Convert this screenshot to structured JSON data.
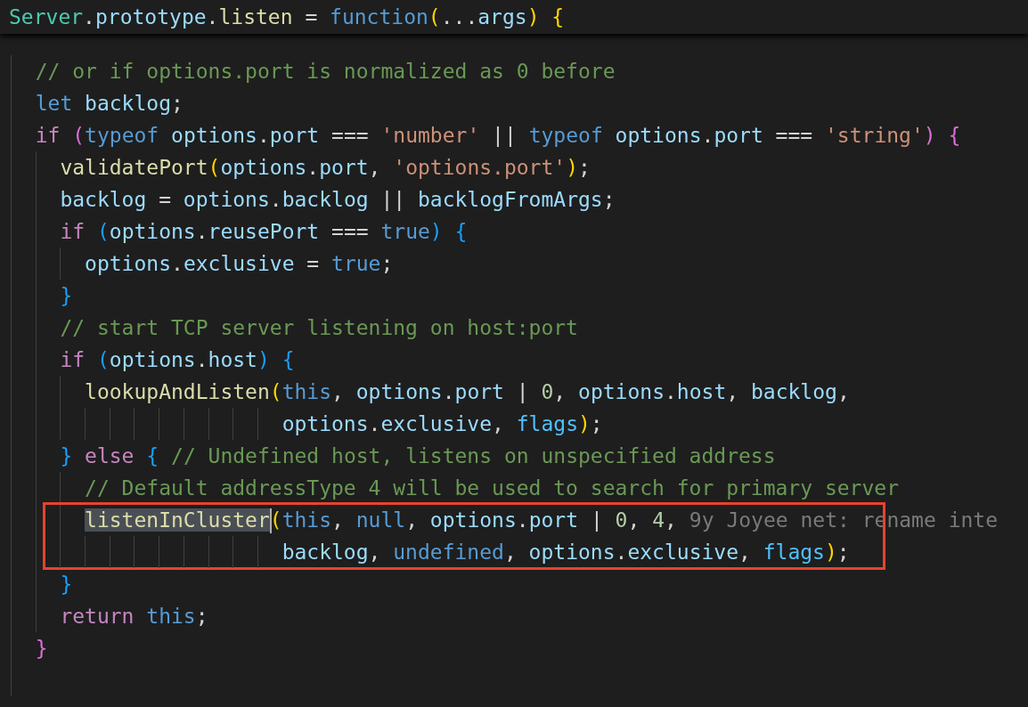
{
  "sticky_header": {
    "tokens": [
      {
        "kind": "cls",
        "text": "Server"
      },
      {
        "kind": "op",
        "text": "."
      },
      {
        "kind": "var",
        "text": "prototype"
      },
      {
        "kind": "op",
        "text": "."
      },
      {
        "kind": "fn",
        "text": "listen"
      },
      {
        "kind": "op",
        "text": " = "
      },
      {
        "kind": "kw",
        "text": "function"
      },
      {
        "kind": "b1",
        "text": "("
      },
      {
        "kind": "op",
        "text": "..."
      },
      {
        "kind": "var",
        "text": "args"
      },
      {
        "kind": "b1",
        "text": ")"
      },
      {
        "kind": "b1",
        "text": " {"
      }
    ]
  },
  "lines": [
    {
      "kind": "code",
      "boxed": false,
      "tokens": [
        {
          "kind": "cmt",
          "text": "// or if options.port is normalized as 0 before"
        }
      ]
    },
    {
      "kind": "code",
      "boxed": false,
      "tokens": [
        {
          "kind": "kw",
          "text": "let"
        },
        {
          "kind": "var",
          "text": " backlog"
        },
        {
          "kind": "op",
          "text": ";"
        }
      ]
    },
    {
      "kind": "code",
      "boxed": false,
      "tokens": [
        {
          "kind": "ctl",
          "text": "if"
        },
        {
          "kind": "b2",
          "text": " ("
        },
        {
          "kind": "kw",
          "text": "typeof"
        },
        {
          "kind": "var",
          "text": " options"
        },
        {
          "kind": "op",
          "text": "."
        },
        {
          "kind": "var",
          "text": "port"
        },
        {
          "kind": "op",
          "text": " === "
        },
        {
          "kind": "str",
          "text": "'number'"
        },
        {
          "kind": "op",
          "text": " || "
        },
        {
          "kind": "kw",
          "text": "typeof"
        },
        {
          "kind": "var",
          "text": " options"
        },
        {
          "kind": "op",
          "text": "."
        },
        {
          "kind": "var",
          "text": "port"
        },
        {
          "kind": "op",
          "text": " === "
        },
        {
          "kind": "str",
          "text": "'string'"
        },
        {
          "kind": "b2",
          "text": ")"
        },
        {
          "kind": "b2",
          "text": " {"
        }
      ],
      "children": [
        {
          "kind": "code",
          "boxed": false,
          "tokens": [
            {
              "kind": "fn",
              "text": "validatePort"
            },
            {
              "kind": "b1",
              "text": "("
            },
            {
              "kind": "var",
              "text": "options"
            },
            {
              "kind": "op",
              "text": "."
            },
            {
              "kind": "var",
              "text": "port"
            },
            {
              "kind": "op",
              "text": ", "
            },
            {
              "kind": "str",
              "text": "'options.port'"
            },
            {
              "kind": "b1",
              "text": ")"
            },
            {
              "kind": "op",
              "text": ";"
            }
          ]
        },
        {
          "kind": "code",
          "boxed": false,
          "tokens": [
            {
              "kind": "var",
              "text": "backlog"
            },
            {
              "kind": "op",
              "text": " = "
            },
            {
              "kind": "var",
              "text": "options"
            },
            {
              "kind": "op",
              "text": "."
            },
            {
              "kind": "var",
              "text": "backlog"
            },
            {
              "kind": "op",
              "text": " || "
            },
            {
              "kind": "var",
              "text": "backlogFromArgs"
            },
            {
              "kind": "op",
              "text": ";"
            }
          ]
        },
        {
          "kind": "code",
          "boxed": false,
          "tokens": [
            {
              "kind": "ctl",
              "text": "if"
            },
            {
              "kind": "b3",
              "text": " ("
            },
            {
              "kind": "var",
              "text": "options"
            },
            {
              "kind": "op",
              "text": "."
            },
            {
              "kind": "var",
              "text": "reusePort"
            },
            {
              "kind": "op",
              "text": " === "
            },
            {
              "kind": "kw",
              "text": "true"
            },
            {
              "kind": "b3",
              "text": ")"
            },
            {
              "kind": "b3",
              "text": " {"
            }
          ],
          "children": [
            {
              "kind": "code",
              "boxed": false,
              "tokens": [
                {
                  "kind": "var",
                  "text": "options"
                },
                {
                  "kind": "op",
                  "text": "."
                },
                {
                  "kind": "var",
                  "text": "exclusive"
                },
                {
                  "kind": "op",
                  "text": " = "
                },
                {
                  "kind": "kw",
                  "text": "true"
                },
                {
                  "kind": "op",
                  "text": ";"
                }
              ]
            }
          ]
        },
        {
          "kind": "code",
          "boxed": false,
          "tokens": [
            {
              "kind": "b3",
              "text": "}"
            }
          ]
        },
        {
          "kind": "code",
          "boxed": false,
          "tokens": [
            {
              "kind": "cmt",
              "text": "// start TCP server listening on host:port"
            }
          ]
        },
        {
          "kind": "code",
          "boxed": false,
          "tokens": [
            {
              "kind": "ctl",
              "text": "if"
            },
            {
              "kind": "b3",
              "text": " ("
            },
            {
              "kind": "var",
              "text": "options"
            },
            {
              "kind": "op",
              "text": "."
            },
            {
              "kind": "var",
              "text": "host"
            },
            {
              "kind": "b3",
              "text": ")"
            },
            {
              "kind": "b3",
              "text": " {"
            }
          ],
          "children": [
            {
              "kind": "code",
              "boxed": false,
              "tokens": [
                {
                  "kind": "fn",
                  "text": "lookupAndListen"
                },
                {
                  "kind": "b1",
                  "text": "("
                },
                {
                  "kind": "kw",
                  "text": "this"
                },
                {
                  "kind": "op",
                  "text": ", "
                },
                {
                  "kind": "var",
                  "text": "options"
                },
                {
                  "kind": "op",
                  "text": "."
                },
                {
                  "kind": "var",
                  "text": "port"
                },
                {
                  "kind": "op",
                  "text": " | "
                },
                {
                  "kind": "num",
                  "text": "0"
                },
                {
                  "kind": "op",
                  "text": ", "
                },
                {
                  "kind": "var",
                  "text": "options"
                },
                {
                  "kind": "op",
                  "text": "."
                },
                {
                  "kind": "var",
                  "text": "host"
                },
                {
                  "kind": "op",
                  "text": ", "
                },
                {
                  "kind": "var",
                  "text": "backlog"
                },
                {
                  "kind": "op",
                  "text": ","
                }
              ]
            },
            {
              "kind": "continuation",
              "boxed": false,
              "tokens": [
                {
                  "kind": "var",
                  "text": "options"
                },
                {
                  "kind": "op",
                  "text": "."
                },
                {
                  "kind": "var",
                  "text": "exclusive"
                },
                {
                  "kind": "op",
                  "text": ", "
                },
                {
                  "kind": "const",
                  "text": "flags"
                },
                {
                  "kind": "b1",
                  "text": ")"
                },
                {
                  "kind": "op",
                  "text": ";"
                }
              ]
            }
          ]
        },
        {
          "kind": "code",
          "boxed": false,
          "tokens": [
            {
              "kind": "b3",
              "text": "}"
            },
            {
              "kind": "ctl",
              "text": " else"
            },
            {
              "kind": "b3",
              "text": " {"
            },
            {
              "kind": "cmt",
              "text": " // Undefined host, listens on unspecified address"
            }
          ],
          "children": [
            {
              "kind": "code",
              "boxed": false,
              "tokens": [
                {
                  "kind": "cmt",
                  "text": "// Default addressType 4 will be used to search for primary server"
                }
              ]
            },
            {
              "kind": "code",
              "boxed": true,
              "blame": "9y Joyee net: rename inte",
              "tokens": [
                {
                  "kind": "selection",
                  "text": "listenInCluster"
                },
                {
                  "kind": "b1",
                  "text": "("
                },
                {
                  "kind": "kw",
                  "text": "this"
                },
                {
                  "kind": "op",
                  "text": ", "
                },
                {
                  "kind": "kw",
                  "text": "null"
                },
                {
                  "kind": "op",
                  "text": ", "
                },
                {
                  "kind": "var",
                  "text": "options"
                },
                {
                  "kind": "op",
                  "text": "."
                },
                {
                  "kind": "var",
                  "text": "port"
                },
                {
                  "kind": "op",
                  "text": " | "
                },
                {
                  "kind": "num",
                  "text": "0"
                },
                {
                  "kind": "op",
                  "text": ", "
                },
                {
                  "kind": "num",
                  "text": "4"
                },
                {
                  "kind": "op",
                  "text": ","
                }
              ]
            },
            {
              "kind": "continuation",
              "boxed": true,
              "tokens": [
                {
                  "kind": "var",
                  "text": "backlog"
                },
                {
                  "kind": "op",
                  "text": ", "
                },
                {
                  "kind": "kw",
                  "text": "undefined"
                },
                {
                  "kind": "op",
                  "text": ", "
                },
                {
                  "kind": "var",
                  "text": "options"
                },
                {
                  "kind": "op",
                  "text": "."
                },
                {
                  "kind": "var",
                  "text": "exclusive"
                },
                {
                  "kind": "op",
                  "text": ", "
                },
                {
                  "kind": "const",
                  "text": "flags"
                },
                {
                  "kind": "b1",
                  "text": ")"
                },
                {
                  "kind": "op",
                  "text": ";"
                }
              ]
            }
          ]
        },
        {
          "kind": "code",
          "boxed": false,
          "tokens": [
            {
              "kind": "b3",
              "text": "}"
            }
          ]
        },
        {
          "kind": "code",
          "boxed": false,
          "tokens": [
            {
              "kind": "ctl",
              "text": "return"
            },
            {
              "kind": "kw",
              "text": " this"
            },
            {
              "kind": "op",
              "text": ";"
            }
          ]
        }
      ]
    },
    {
      "kind": "code",
      "boxed": false,
      "tokens": [
        {
          "kind": "b2",
          "text": "}"
        }
      ]
    },
    {
      "kind": "blank",
      "boxed": false
    }
  ]
}
